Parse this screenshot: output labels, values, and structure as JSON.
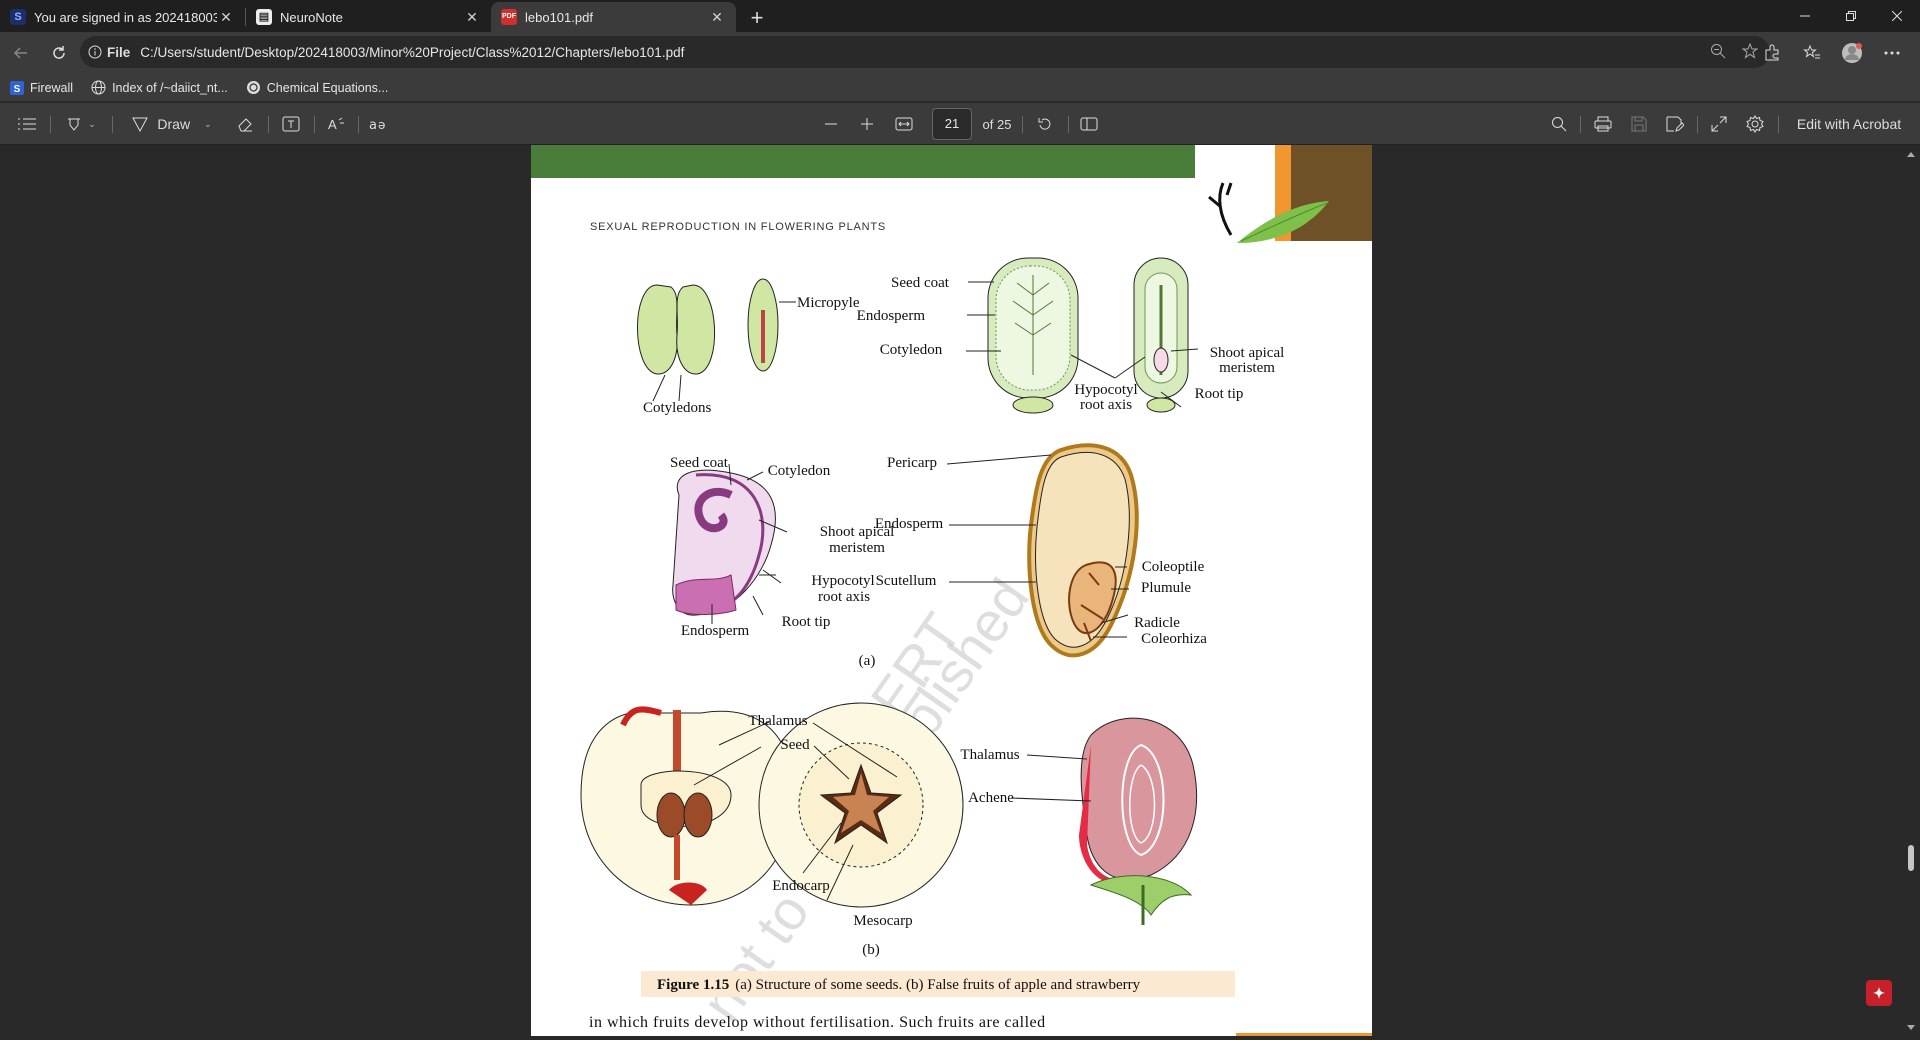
{
  "tabs": [
    {
      "title": "You are signed in as 202418003",
      "icon": "S",
      "icon_name": "sophos-s-icon",
      "color": "#2d4fb8"
    },
    {
      "title": "NeuroNote",
      "icon": "≡",
      "icon_name": "notebook-icon",
      "color": "#d98b2b"
    },
    {
      "title": "lebo101.pdf",
      "icon": "PDF",
      "icon_name": "pdf-file-icon",
      "color": "#d12e2e"
    }
  ],
  "address": {
    "scheme_label": "File",
    "url": "C:/Users/student/Desktop/202418003/Minor%20Project/Class%2012/Chapters/lebo101.pdf"
  },
  "favorites": [
    {
      "label": "Firewall",
      "icon": "sophos-s-icon"
    },
    {
      "label": "Index of /~daiict_nt...",
      "icon": "globe-icon"
    },
    {
      "label": "Chemical Equations...",
      "icon": "chatgpt-icon"
    }
  ],
  "pdf_toolbar": {
    "draw_label": "Draw",
    "page_current": "21",
    "page_total_label": "of 25",
    "edit_label": "Edit with Acrobat"
  },
  "document": {
    "running_head": "SEXUAL REPRODUCTION IN FLOWERING PLANTS",
    "labels": {
      "cotyledons": "Cotyledons",
      "micropyle": "Micropyle",
      "seed_coat": "Seed coat",
      "endosperm": "Endosperm",
      "cotyledon": "Cotyledon",
      "hypocotyl_1": "Hypocotyl",
      "hypocotyl_2": "root axis",
      "shoot_1": "Shoot apical",
      "shoot_2": "meristem",
      "root_tip": "Root tip",
      "pericarp": "Pericarp",
      "scutellum": "Scutellum",
      "coleoptile": "Coleoptile",
      "plumule": "Plumule",
      "radicle": "Radicle",
      "coleorhiza": "Coleorhiza",
      "part_a": "(a)",
      "part_b": "(b)",
      "thalamus": "Thalamus",
      "seed": "Seed",
      "endocarp": "Endocarp",
      "mesocarp": "Mesocarp",
      "achene": "Achene"
    },
    "caption_bold": "Figure 1.15",
    "caption_text": "(a) Structure of some seeds. (b) False fruits of apple and strawberry",
    "body_line": "in which fruits develop without fertilisation. Such fruits are called",
    "watermark_1": "© NCERT",
    "watermark_2": "not to be republished"
  },
  "colors": {
    "header_green": "#4a7c3a",
    "header_orange": "#f0962e",
    "header_brown": "#6e5126",
    "caption_bg": "#fbe9d2"
  }
}
